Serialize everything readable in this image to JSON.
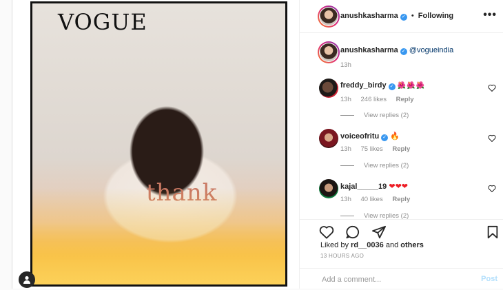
{
  "post": {
    "author": "anushkasharma",
    "follow_status": "Following",
    "more_icon": "more-horizontal-icon"
  },
  "media": {
    "magazine_logo": "VOGUE",
    "shirt_text": "thank",
    "tag_icon": "user-tag-icon"
  },
  "caption": {
    "username": "anushkasharma",
    "text": "@vogueindia",
    "time": "13h"
  },
  "comments": [
    {
      "username": "freddy_birdy",
      "verified": true,
      "text": "🌺🌺🌺",
      "time": "13h",
      "likes": "246 likes",
      "reply": "Reply",
      "view_replies": "View replies (2)"
    },
    {
      "username": "voiceofritu",
      "verified": true,
      "text": "🔥",
      "time": "13h",
      "likes": "75 likes",
      "reply": "Reply",
      "view_replies": "View replies (2)"
    },
    {
      "username": "kajal_____19",
      "verified": false,
      "text": "❤❤❤",
      "time": "13h",
      "likes": "40 likes",
      "reply": "Reply",
      "view_replies": "View replies (2)"
    }
  ],
  "actions": {
    "like_icon": "heart-icon",
    "comment_icon": "comment-icon",
    "share_icon": "share-icon",
    "save_icon": "bookmark-icon"
  },
  "likes": {
    "prefix": "Liked by",
    "user": "rd__0036",
    "conjunction": "and",
    "others": "others"
  },
  "timestamp": "13 HOURS AGO",
  "add_comment": {
    "placeholder": "Add a comment...",
    "post_label": "Post"
  },
  "colors": {
    "verified_blue": "#3897f0",
    "post_button": "#b2dffc",
    "mention": "#003569"
  }
}
